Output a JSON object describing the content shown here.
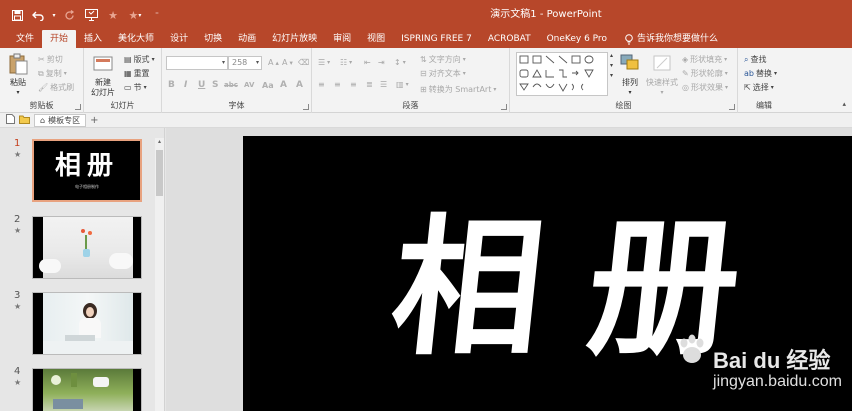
{
  "window": {
    "title": "演示文稿1  -  PowerPoint"
  },
  "qat": {
    "icons": [
      "save-icon",
      "undo-icon",
      "redo-icon",
      "slideshow-icon",
      "star-icon",
      "star-dropdown-icon",
      "customize-icon"
    ]
  },
  "tabs": [
    {
      "label": "文件"
    },
    {
      "label": "开始"
    },
    {
      "label": "插入"
    },
    {
      "label": "美化大师"
    },
    {
      "label": "设计"
    },
    {
      "label": "切换"
    },
    {
      "label": "动画"
    },
    {
      "label": "幻灯片放映"
    },
    {
      "label": "审阅"
    },
    {
      "label": "视图"
    },
    {
      "label": "ISPRING FREE 7"
    },
    {
      "label": "ACROBAT"
    },
    {
      "label": "OneKey 6 Pro"
    }
  ],
  "tellme": {
    "label": "告诉我你想要做什么"
  },
  "ribbon": {
    "clipboard": {
      "label": "剪贴板",
      "paste": "粘贴",
      "cut": "剪切",
      "copy": "复制",
      "format_painter": "格式刷"
    },
    "slides": {
      "label": "幻灯片",
      "new_slide": "新建\n幻灯片",
      "layout": "版式",
      "reset": "重置",
      "section": "节"
    },
    "font": {
      "label": "字体",
      "font_name": "",
      "font_size": "258",
      "buttons": [
        "B",
        "I",
        "U",
        "S",
        "abc",
        "AV",
        "Aa",
        "A",
        "A"
      ]
    },
    "paragraph": {
      "label": "段落",
      "text_direction": "文字方向",
      "align_text": "对齐文本",
      "smartart": "转换为 SmartArt"
    },
    "drawing": {
      "label": "绘图",
      "arrange": "排列",
      "quick_styles": "快速样式",
      "shape_fill": "形状填充",
      "shape_outline": "形状轮廓",
      "shape_effects": "形状效果"
    },
    "editing": {
      "label": "编辑",
      "find": "查找",
      "replace": "替换",
      "select": "选择"
    }
  },
  "subbar": {
    "tab_label": "模板专区"
  },
  "thumbnails": [
    {
      "num": "1",
      "star": "★",
      "title": "相册",
      "subtitle": "电子相册制作"
    },
    {
      "num": "2",
      "star": "★"
    },
    {
      "num": "3",
      "star": "★"
    },
    {
      "num": "4",
      "star": "★"
    }
  ],
  "slide": {
    "title": "相册"
  },
  "watermark": {
    "brand": "Bai du 经验",
    "url": "jingyan.baidu.com"
  }
}
